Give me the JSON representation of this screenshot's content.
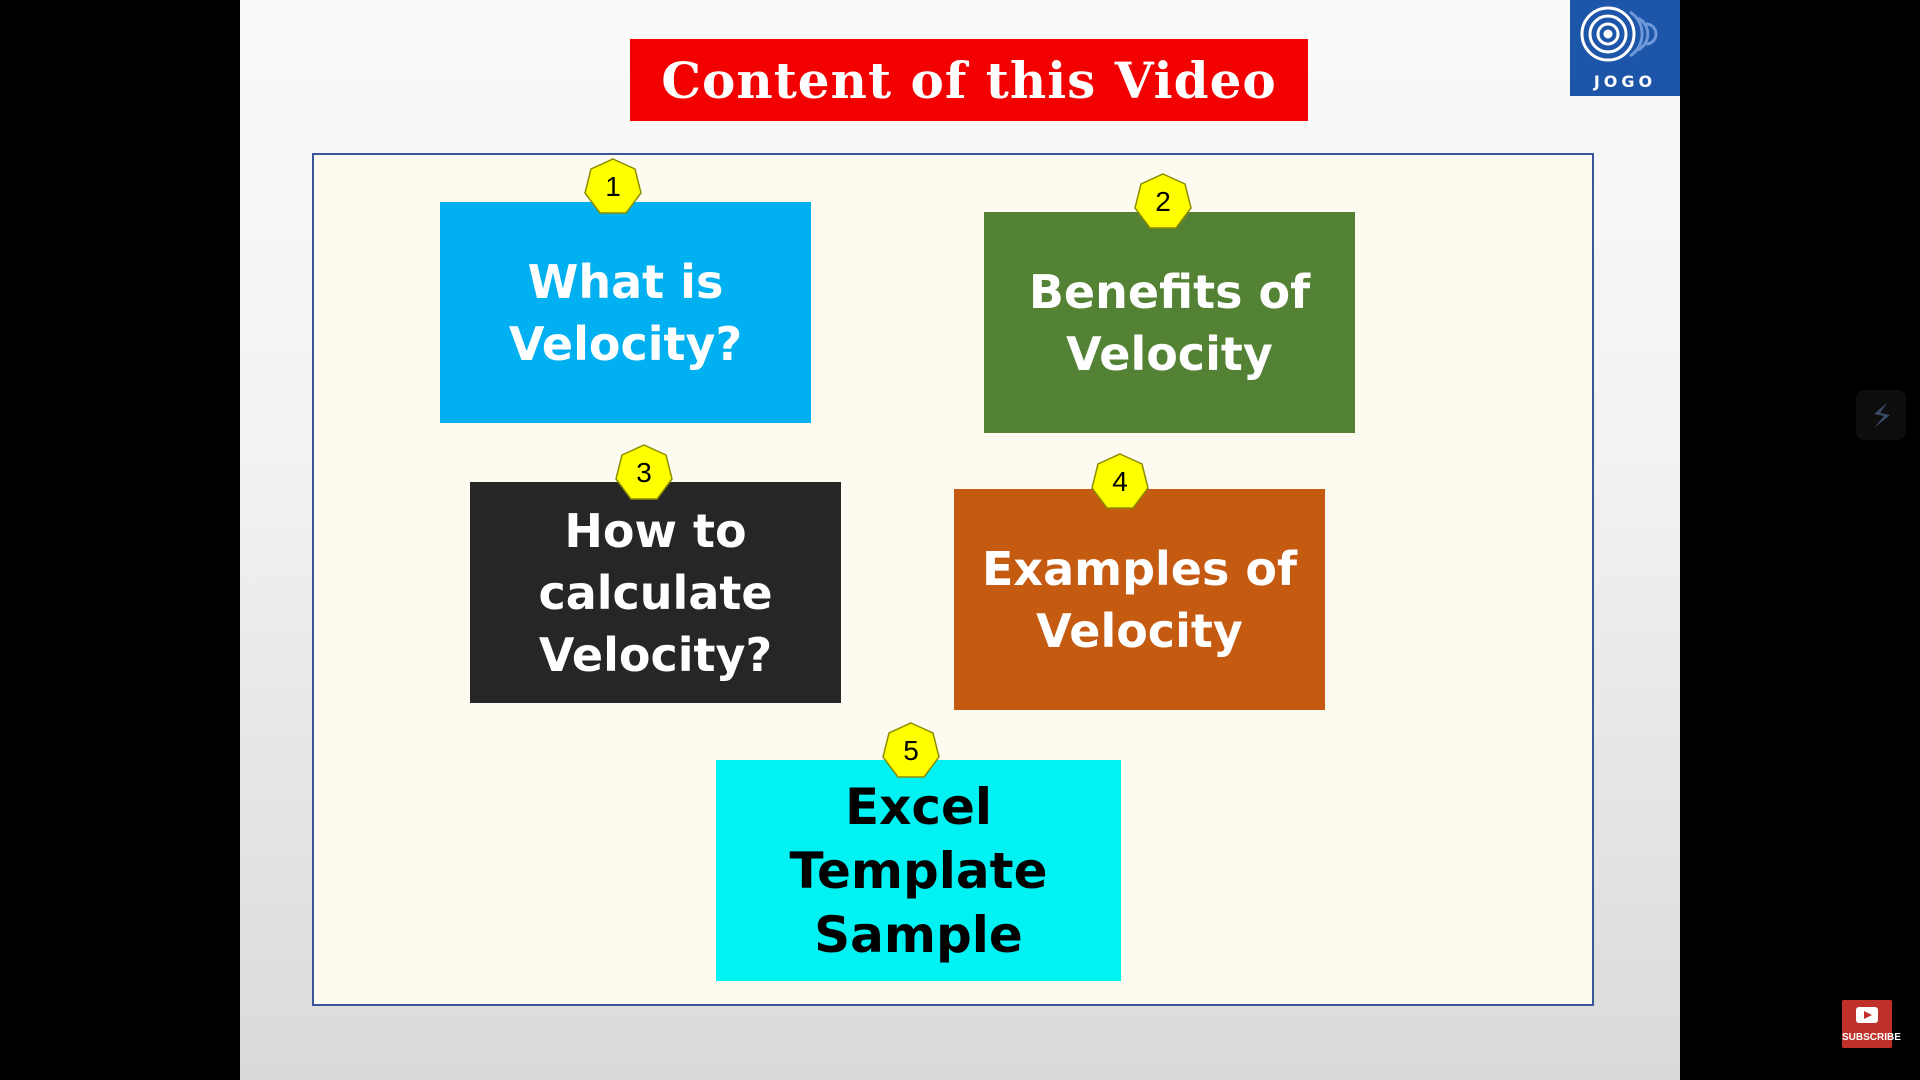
{
  "slide": {
    "title": "Content of this Video",
    "logo_text": "JOGO",
    "topics": [
      {
        "number": "1",
        "label": "What is\nVelocity?",
        "color": "#00b0f0"
      },
      {
        "number": "2",
        "label": "Benefits of\nVelocity",
        "color": "#548235"
      },
      {
        "number": "3",
        "label": "How to\ncalculate\nVelocity?",
        "color": "#262626"
      },
      {
        "number": "4",
        "label": "Examples of\nVelocity",
        "color": "#c55a11"
      },
      {
        "number": "5",
        "label": "Excel Template\nSample",
        "color": "#00f2f2"
      }
    ],
    "badge_color": "#ffff00",
    "title_bar_color": "#f30000"
  },
  "overlay": {
    "subscribe_label": "SUBSCRIBE",
    "side_icon": "stack-icon",
    "subscribe_icon": "youtube-play-icon"
  }
}
